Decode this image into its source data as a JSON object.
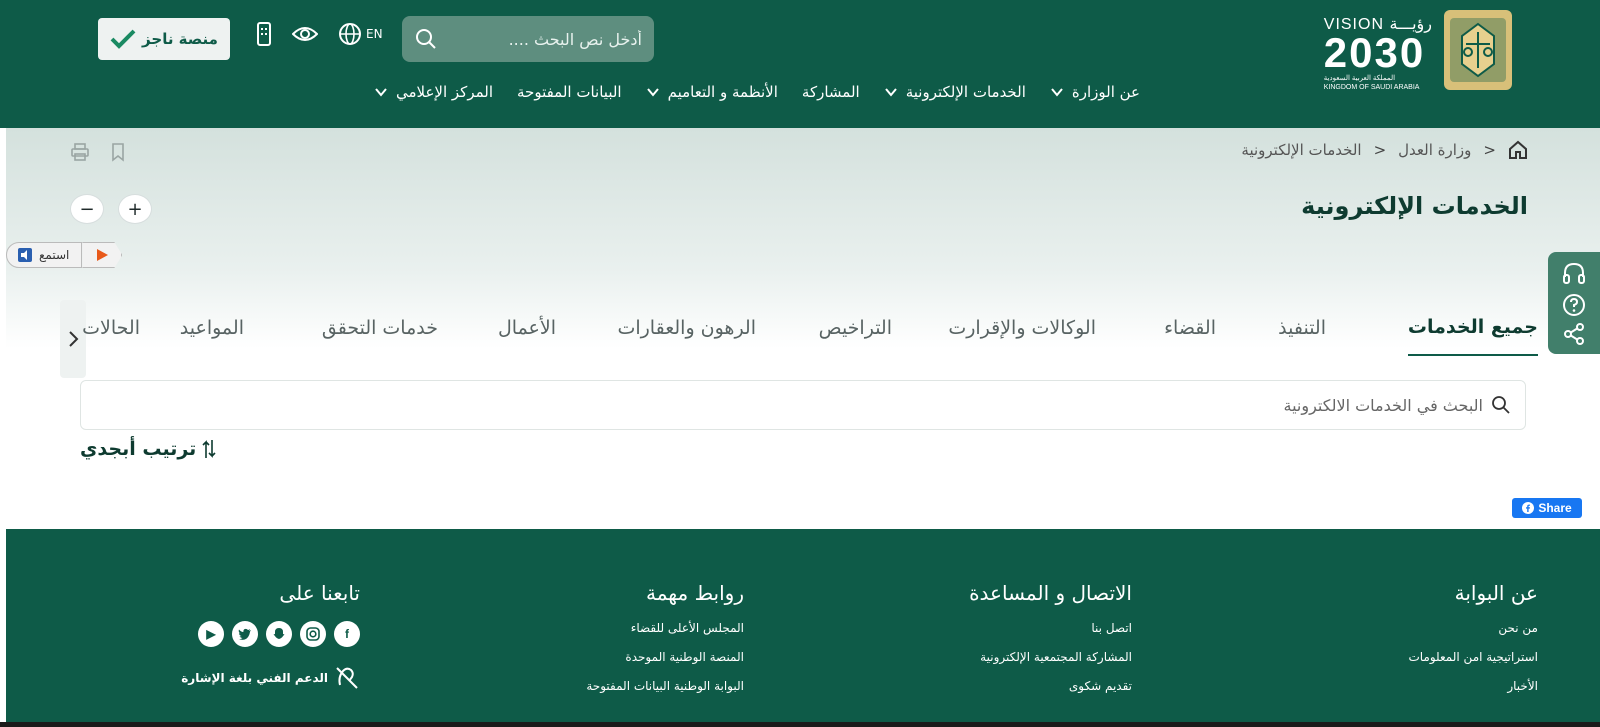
{
  "header": {
    "logo": {
      "vision_label": "VISION",
      "vision_arabic": "رؤيـــة",
      "year": "2030",
      "kingdom_ar": "المملكة العربية السعودية",
      "kingdom_en": "KINGDOM OF SAUDI ARABIA"
    },
    "nav": [
      {
        "label": "عن الوزارة",
        "has_dropdown": true
      },
      {
        "label": "الخدمات الإلكترونية",
        "has_dropdown": true
      },
      {
        "label": "المشاركة",
        "has_dropdown": false
      },
      {
        "label": "الأنظمة و التعاميم",
        "has_dropdown": true
      },
      {
        "label": "البيانات المفتوحة",
        "has_dropdown": false
      },
      {
        "label": "المركز الإعلامي",
        "has_dropdown": true
      }
    ],
    "search": {
      "placeholder": "أدخل نص البحث ....",
      "icon": "search-icon"
    },
    "language_label": "EN",
    "najiz_label": "منصة ناجز",
    "colors": {
      "header_bg": "#0e5b48",
      "accent": "#0e5b48"
    }
  },
  "breadcrumb": {
    "home_icon": "home-icon",
    "items": [
      "وزارة العدل",
      "الخدمات الإلكترونية"
    ],
    "separator": ">"
  },
  "page": {
    "title": "الخدمات الإلكترونية"
  },
  "listen_label": "استمع",
  "tabs": [
    {
      "label": "جميع الخدمات",
      "active": true
    },
    {
      "label": "التنفيذ",
      "active": false
    },
    {
      "label": "القضاء",
      "active": false
    },
    {
      "label": "الوكالات والإقرارت",
      "active": false
    },
    {
      "label": "التراخيص",
      "active": false
    },
    {
      "label": "الرهون والعقارات",
      "active": false
    },
    {
      "label": "الأعمال",
      "active": false
    },
    {
      "label": "خدمات التحقق",
      "active": false
    },
    {
      "label": "المواعيد",
      "active": false
    },
    {
      "label": "الحالات",
      "active": false
    }
  ],
  "services_search": {
    "placeholder": "البحث في الخدمات الالكترونية"
  },
  "sort_label": "ترتيب أبجدي",
  "share_label": "Share",
  "footer": {
    "about": {
      "title": "عن البوابة",
      "links": [
        "من نحن",
        "استراتيجية امن المعلومات",
        "الأخبار"
      ]
    },
    "contact": {
      "title": "الاتصال و المساعدة",
      "links": [
        "اتصل بنا",
        "المشاركة المجتمعية الإلكترونية",
        "تقديم شكوى"
      ]
    },
    "links": {
      "title": "روابط مهمة",
      "links": [
        "المجلس الأعلى للقضاء",
        "المنصة الوطنية الموحدة",
        "البوابة الوطنية البيانات المفتوحة"
      ]
    },
    "follow": {
      "title": "تابعنا على",
      "social": [
        "facebook-icon",
        "instagram-icon",
        "snapchat-icon",
        "twitter-icon",
        "youtube-icon"
      ],
      "sign_language": "الدعم الفني بلغة الإشارة"
    }
  }
}
